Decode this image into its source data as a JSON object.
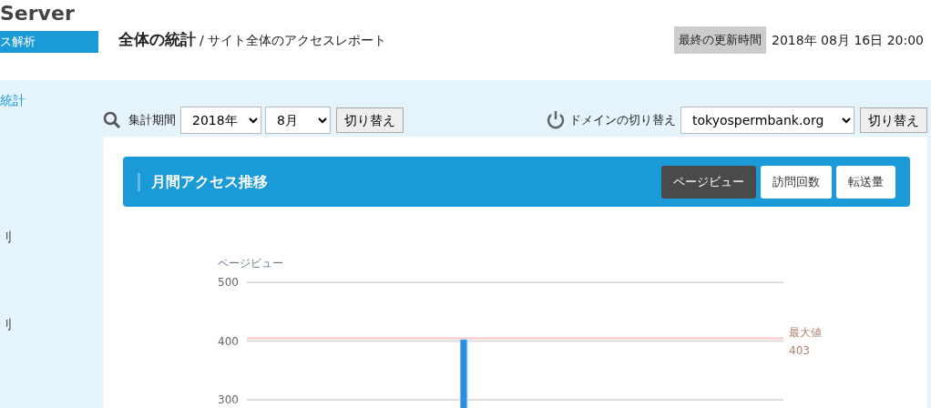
{
  "brand": {
    "logo": "Server",
    "section": "ス解析"
  },
  "sidebar": {
    "items": [
      {
        "label": "統計",
        "selected": true
      },
      {
        "label": "刂",
        "selected": false
      },
      {
        "label": "刂",
        "selected": false
      }
    ]
  },
  "header": {
    "title": "全体の統計",
    "separator": "/",
    "subtitle": "サイト全体のアクセスレポート",
    "updated_label": "最終の更新時間",
    "updated_value": "2018年 08月 16日 20:00"
  },
  "period": {
    "label": "集計期間",
    "year": "2018年",
    "month": "8月",
    "button": "切り替え"
  },
  "domain": {
    "label": "ドメインの切り替え",
    "value": "tokyospermbank.org",
    "button": "切り替え"
  },
  "panel": {
    "title": "月間アクセス推移",
    "tabs": [
      {
        "label": "ページビュー",
        "selected": true
      },
      {
        "label": "訪問回数",
        "selected": false
      },
      {
        "label": "転送量",
        "selected": false
      }
    ],
    "chart_data": {
      "type": "bar",
      "ylabel": "ページビュー",
      "ylim": [
        285,
        500
      ],
      "yticks": [
        300,
        400,
        500
      ],
      "values": [
        403
      ],
      "ref_lines": [
        {
          "axis": "y",
          "value": 403,
          "label": "最大値",
          "color": "#f7c6c6"
        }
      ],
      "annotations": [
        "403"
      ]
    }
  }
}
